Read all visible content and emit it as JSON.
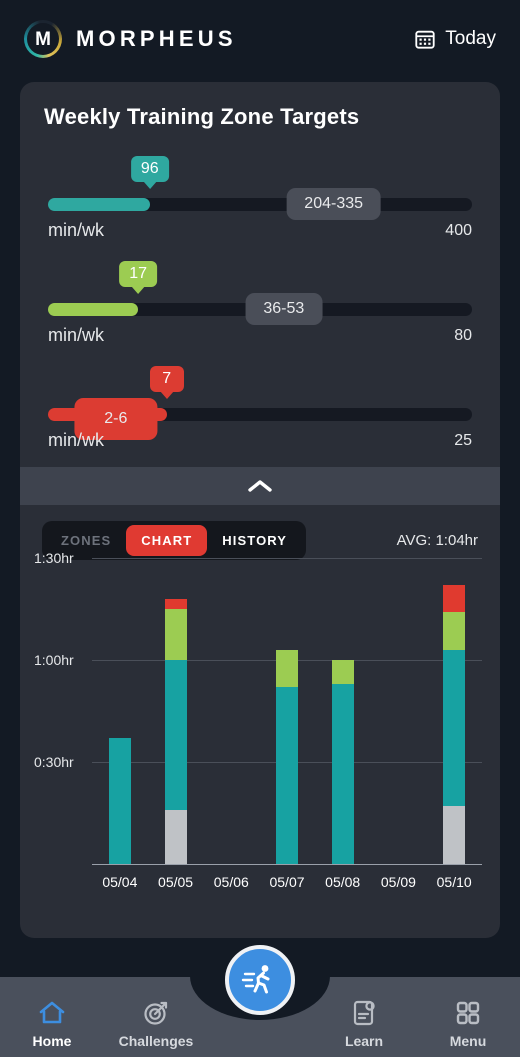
{
  "header": {
    "brand": "MORPHEUS",
    "logo_letter": "M",
    "today_label": "Today",
    "calendar_icon": "calendar-icon"
  },
  "card": {
    "title": "Weekly Training Zone Targets",
    "collapse_icon": "chevron-up-icon",
    "sliders": [
      {
        "zone": "zone-1",
        "value": "96",
        "value_num": 96,
        "range": "204-335",
        "range_min": 204,
        "range_max": 335,
        "unit": "min/wk",
        "max": "400",
        "max_num": 400,
        "color": "#2fa8a0"
      },
      {
        "zone": "zone-2",
        "value": "17",
        "value_num": 17,
        "range": "36-53",
        "range_min": 36,
        "range_max": 53,
        "unit": "min/wk",
        "max": "80",
        "max_num": 80,
        "color": "#9ccc52"
      },
      {
        "zone": "zone-3",
        "value": "7",
        "value_num": 7,
        "range": "2-6",
        "range_min": 2,
        "range_max": 6,
        "unit": "min/wk",
        "max": "25",
        "max_num": 25,
        "color": "#dc3c32"
      }
    ],
    "tabs": [
      {
        "label": "ZONES",
        "active": false
      },
      {
        "label": "CHART",
        "active": true
      },
      {
        "label": "HISTORY",
        "active": false
      }
    ],
    "avg_label": "AVG: 1:04hr"
  },
  "chart_data": {
    "type": "bar",
    "stacked": true,
    "title": "",
    "xlabel": "",
    "ylabel": "",
    "categories": [
      "05/04",
      "05/05",
      "05/06",
      "05/07",
      "05/08",
      "05/09",
      "05/10"
    ],
    "ytick_labels": [
      "0:30hr",
      "1:00hr",
      "1:30hr"
    ],
    "ytick_values": [
      30,
      60,
      90
    ],
    "ylim": [
      0,
      97
    ],
    "unit": "minutes",
    "grid": true,
    "legend": "none",
    "series": [
      {
        "name": "recovery",
        "color": "#bfc2c6",
        "values": [
          0,
          16,
          0,
          0,
          0,
          0,
          17
        ]
      },
      {
        "name": "zone-1",
        "color": "#17a2a2",
        "values": [
          37,
          44,
          0,
          52,
          53,
          0,
          46
        ]
      },
      {
        "name": "zone-2",
        "color": "#9ccc52",
        "values": [
          0,
          15,
          0,
          11,
          7,
          0,
          11
        ]
      },
      {
        "name": "zone-3",
        "color": "#e03a2f",
        "values": [
          0,
          3,
          0,
          0,
          0,
          0,
          8
        ]
      }
    ],
    "totals": [
      37,
      78,
      0,
      63,
      60,
      0,
      82
    ]
  },
  "bottom_nav": {
    "items": [
      {
        "label": "Home",
        "icon": "home-icon",
        "active": true
      },
      {
        "label": "Challenges",
        "icon": "target-icon",
        "active": false
      },
      {
        "label": "Learn",
        "icon": "book-icon",
        "active": false
      },
      {
        "label": "Menu",
        "icon": "grid-icon",
        "active": false
      }
    ],
    "fab_icon": "runner-icon"
  },
  "colors": {
    "page_bg": "#131a24",
    "card_bg": "#2a2e37",
    "accent_red": "#e03a32",
    "teal": "#17a2a2",
    "green": "#9ccc52",
    "red": "#e03a2f",
    "gray": "#bfc2c6",
    "nav_blue": "#3d8ee0"
  }
}
